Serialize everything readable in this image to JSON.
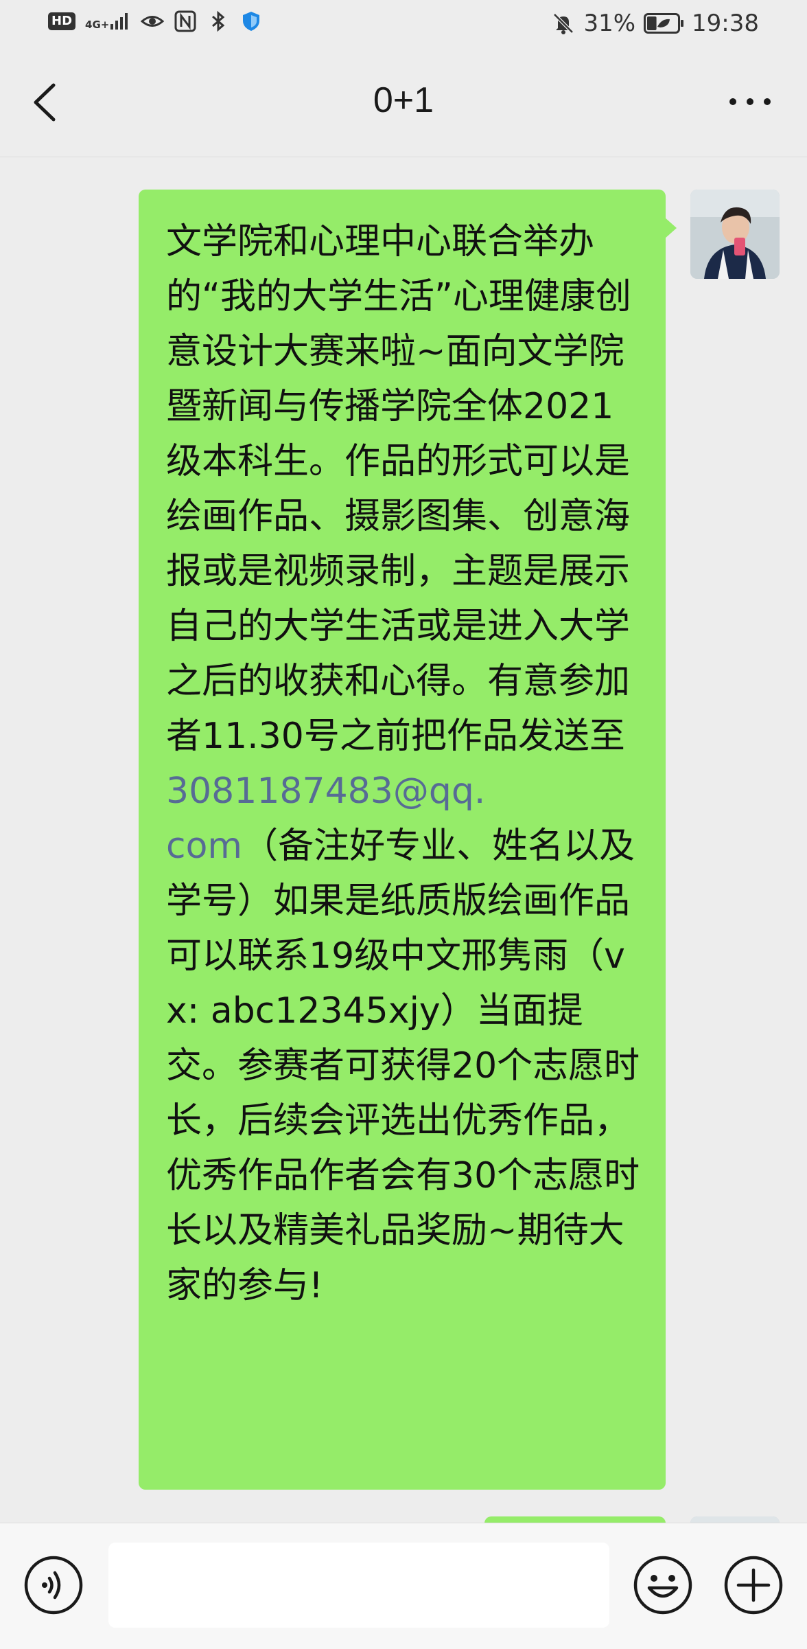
{
  "status_bar": {
    "hd_badge": "HD",
    "network": "4G+",
    "battery_percent": "31%",
    "battery_level": 0.31,
    "time": "19:38"
  },
  "header": {
    "title": "0+1",
    "back_icon": "chevron-left-icon",
    "more_icon": "more-horizontal-icon"
  },
  "messages": [
    {
      "sender": "self",
      "text_before_link": "文学院和心理中心联合举办的“我的大学生活”心理健康创意设计大赛来啦~面向文学院暨新闻与传播学院全体2021级本科生。作品的形式可以是绘画作品、摄影图集、创意海报或是视频录制，主题是展示自己的大学生活或是进入大学之后的收获和心得。有意参加者11.30号之前把作品发送至",
      "link_part1": "3081187483@qq.",
      "link_part2": "com",
      "text_after_link": "（备注好专业、姓名以及学号）如果是纸质版绘画作品可以联系19级中文邢隽雨（vx: abc12345xjy）当面提交。参赛者可获得20个志愿时长，后续会评选出优秀作品，优秀作品作者会有30个志愿时长以及精美礼品奖励~期待大家的参与!"
    }
  ],
  "input_bar": {
    "voice_icon": "voice-icon",
    "emoji_icon": "emoji-icon",
    "plus_icon": "plus-icon",
    "placeholder": ""
  },
  "colors": {
    "bubble_self": "#95ec69",
    "background": "#ededed",
    "link": "#576b95"
  }
}
